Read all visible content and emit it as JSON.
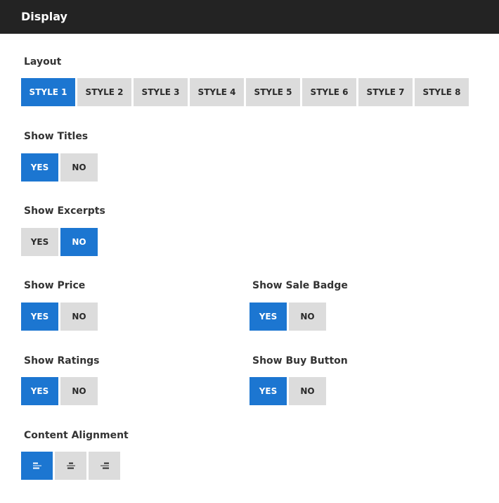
{
  "header": {
    "title": "Display"
  },
  "layout": {
    "label": "Layout",
    "options": [
      "STYLE 1",
      "STYLE 2",
      "STYLE 3",
      "STYLE 4",
      "STYLE 5",
      "STYLE 6",
      "STYLE 7",
      "STYLE 8"
    ],
    "selected": "STYLE 1"
  },
  "show_titles": {
    "label": "Show Titles",
    "yes": "YES",
    "no": "NO",
    "selected": "YES"
  },
  "show_excerpts": {
    "label": "Show Excerpts",
    "yes": "YES",
    "no": "NO",
    "selected": "NO"
  },
  "show_price": {
    "label": "Show Price",
    "yes": "YES",
    "no": "NO",
    "selected": "YES"
  },
  "show_sale_badge": {
    "label": "Show Sale Badge",
    "yes": "YES",
    "no": "NO",
    "selected": "YES"
  },
  "show_ratings": {
    "label": "Show Ratings",
    "yes": "YES",
    "no": "NO",
    "selected": "YES"
  },
  "show_buy_button": {
    "label": "Show Buy Button",
    "yes": "YES",
    "no": "NO",
    "selected": "YES"
  },
  "content_alignment": {
    "label": "Content Alignment",
    "options": [
      {
        "value": "left",
        "icon": "align-left-icon"
      },
      {
        "value": "center",
        "icon": "align-center-icon"
      },
      {
        "value": "right",
        "icon": "align-right-icon"
      }
    ],
    "selected": "left"
  },
  "colors": {
    "header_bg": "#232323",
    "active": "#1c76d1",
    "inactive": "#dcdcdc"
  }
}
